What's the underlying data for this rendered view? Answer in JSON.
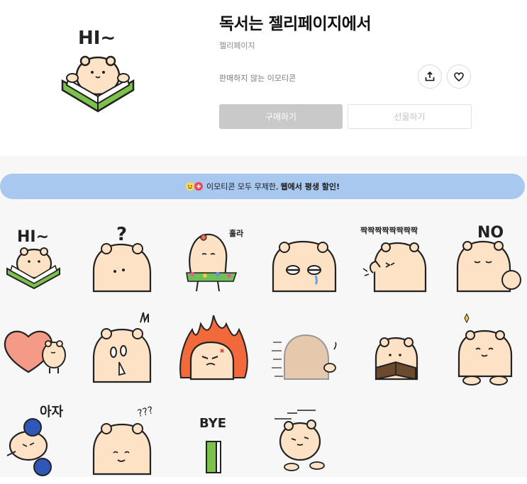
{
  "product": {
    "title": "독서는 젤리페이지에서",
    "author": "젤리페이지",
    "sale_status": "판매하지 않는 이모티콘"
  },
  "actions": {
    "share_icon": "share-icon",
    "like_icon": "heart-icon",
    "buy_label": "구매하기",
    "gift_label": "선물하기"
  },
  "thumbnail": {
    "caption": "HI~"
  },
  "banner": {
    "text_prefix": "이모티콘 모두 무제한,",
    "text_strong": "웹에서 평생 할인!"
  },
  "emoticons": [
    {
      "name": "emoticon-hi",
      "text": "HI~"
    },
    {
      "name": "emoticon-question",
      "text": "?"
    },
    {
      "name": "emoticon-hula",
      "text": "훌라"
    },
    {
      "name": "emoticon-teary",
      "text": ""
    },
    {
      "name": "emoticon-jjak",
      "text": "짝짝짝짝짝짝짝짝"
    },
    {
      "name": "emoticon-no",
      "text": "NO"
    },
    {
      "name": "emoticon-heart",
      "text": ""
    },
    {
      "name": "emoticon-shocked",
      "text": ""
    },
    {
      "name": "emoticon-angry-fire",
      "text": ""
    },
    {
      "name": "emoticon-fast",
      "text": ""
    },
    {
      "name": "emoticon-reading",
      "text": ""
    },
    {
      "name": "emoticon-happy",
      "text": ""
    },
    {
      "name": "emoticon-ajja",
      "text": "아자"
    },
    {
      "name": "emoticon-sleepy",
      "text": "???"
    },
    {
      "name": "emoticon-bye",
      "text": "BYE"
    },
    {
      "name": "emoticon-running",
      "text": ""
    }
  ],
  "colors": {
    "banner_bg": "#a9c8ef",
    "buy_button_bg": "#c9c9c9",
    "character_fill": "#fde2c6",
    "character_outline": "#222222",
    "book_green": "#7cc14a"
  }
}
